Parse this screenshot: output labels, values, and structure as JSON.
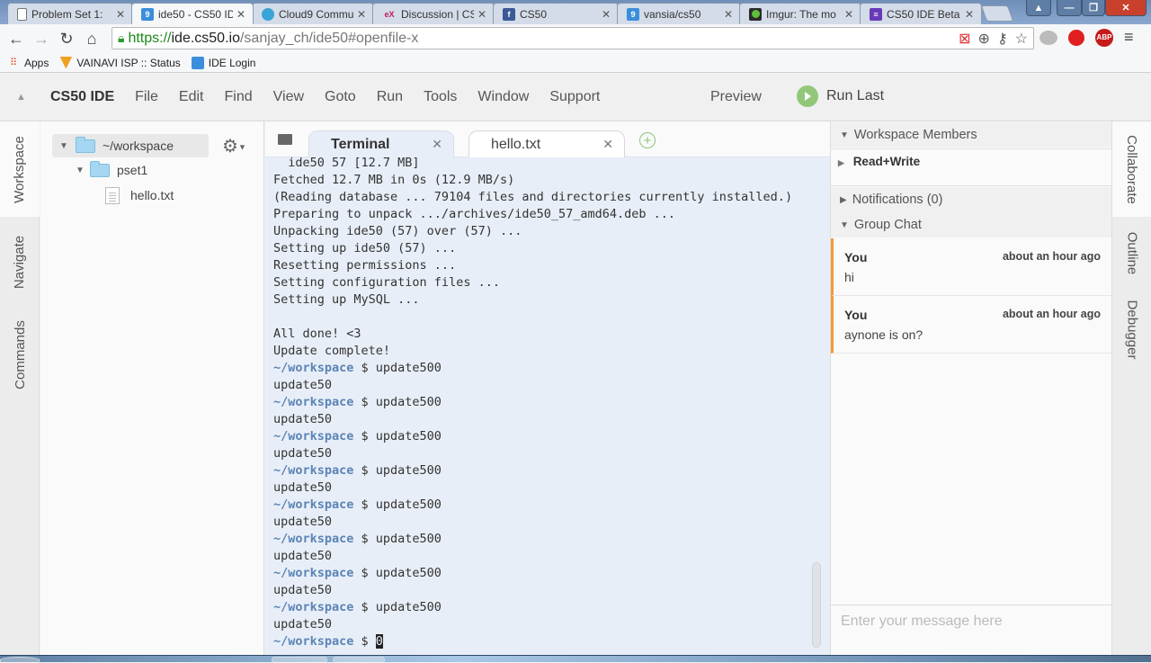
{
  "browser": {
    "tabs": [
      {
        "title": "Problem Set 1:",
        "favicon": "document-icon",
        "active": false
      },
      {
        "title": "ide50 - CS50 ID",
        "favicon": "cloud9-icon",
        "active": true
      },
      {
        "title": "Cloud9 Commu",
        "favicon": "cloud9-community-icon",
        "active": false
      },
      {
        "title": "Discussion | CS",
        "favicon": "edx-icon",
        "active": false
      },
      {
        "title": "CS50",
        "favicon": "facebook-icon",
        "active": false
      },
      {
        "title": "vansia/cs50",
        "favicon": "cloud9-icon",
        "active": false
      },
      {
        "title": "Imgur: The mo",
        "favicon": "imgur-icon",
        "active": false
      },
      {
        "title": "CS50 IDE Beta",
        "favicon": "form-icon",
        "active": false
      }
    ],
    "url": {
      "scheme": "https://",
      "host": "ide.cs50.io",
      "path": "/sanjay_ch/ide50#openfile-x"
    },
    "bookmarks": [
      {
        "label": "Apps",
        "icon": "apps-grid-icon"
      },
      {
        "label": "VAINAVI ISP :: Status",
        "icon": "shield-icon"
      },
      {
        "label": "IDE Login",
        "icon": "cloud9-icon"
      }
    ],
    "extensions": [
      "chat-bubbles-icon",
      "adblock-hand-icon",
      "abp-icon"
    ],
    "abp_label": "ABP"
  },
  "ide": {
    "brand": "CS50 IDE",
    "menu": [
      "File",
      "Edit",
      "Find",
      "View",
      "Goto",
      "Run",
      "Tools",
      "Window",
      "Support"
    ],
    "preview_label": "Preview",
    "run_last_label": "Run Last",
    "left_tabs": [
      "Workspace",
      "Navigate",
      "Commands"
    ],
    "right_tabs": [
      "Collaborate",
      "Outline",
      "Debugger"
    ],
    "tree": {
      "root": "~/workspace",
      "folder": "pset1",
      "file": "hello.txt"
    },
    "editor_tabs": [
      {
        "label": "Terminal",
        "active": true
      },
      {
        "label": "hello.txt",
        "active": false
      }
    ],
    "terminal": {
      "lines": [
        {
          "type": "out",
          "text": "  ide50 57 [12.7 MB]"
        },
        {
          "type": "out",
          "text": "Fetched 12.7 MB in 0s (12.9 MB/s)"
        },
        {
          "type": "out",
          "text": "(Reading database ... 79104 files and directories currently installed.)"
        },
        {
          "type": "out",
          "text": "Preparing to unpack .../archives/ide50_57_amd64.deb ..."
        },
        {
          "type": "out",
          "text": "Unpacking ide50 (57) over (57) ..."
        },
        {
          "type": "out",
          "text": "Setting up ide50 (57) ..."
        },
        {
          "type": "out",
          "text": "Resetting permissions ..."
        },
        {
          "type": "out",
          "text": "Setting configuration files ..."
        },
        {
          "type": "out",
          "text": "Setting up MySQL ..."
        },
        {
          "type": "out",
          "text": ""
        },
        {
          "type": "out",
          "text": "All done! <3"
        },
        {
          "type": "out",
          "text": "Update complete!"
        },
        {
          "type": "cmd",
          "prompt": "~/workspace",
          "text": " $ update500"
        },
        {
          "type": "out",
          "text": "update50"
        },
        {
          "type": "cmd",
          "prompt": "~/workspace",
          "text": " $ update500"
        },
        {
          "type": "out",
          "text": "update50"
        },
        {
          "type": "cmd",
          "prompt": "~/workspace",
          "text": " $ update500"
        },
        {
          "type": "out",
          "text": "update50"
        },
        {
          "type": "cmd",
          "prompt": "~/workspace",
          "text": " $ update500"
        },
        {
          "type": "out",
          "text": "update50"
        },
        {
          "type": "cmd",
          "prompt": "~/workspace",
          "text": " $ update500"
        },
        {
          "type": "out",
          "text": "update50"
        },
        {
          "type": "cmd",
          "prompt": "~/workspace",
          "text": " $ update500"
        },
        {
          "type": "out",
          "text": "update50"
        },
        {
          "type": "cmd",
          "prompt": "~/workspace",
          "text": " $ update500"
        },
        {
          "type": "out",
          "text": "update50"
        },
        {
          "type": "cmd",
          "prompt": "~/workspace",
          "text": " $ update500"
        },
        {
          "type": "out",
          "text": "update50"
        },
        {
          "type": "cur",
          "prompt": "~/workspace",
          "text": " $ ",
          "cursor": "0"
        }
      ]
    },
    "collab": {
      "members_title": "Workspace Members",
      "members_group": "Read+Write",
      "notifications": "Notifications (0)",
      "group_chat": "Group Chat",
      "messages": [
        {
          "author": "You",
          "time": "about an hour ago",
          "text": "hi"
        },
        {
          "author": "You",
          "time": "about an hour ago",
          "text": "aynone is on?"
        }
      ],
      "input_placeholder": "Enter your message here"
    }
  },
  "colors": {
    "accent_orange": "#f29a3a",
    "prompt_blue": "#5a84b6",
    "run_green": "#92c77a",
    "terminal_bg": "#e8eef7"
  }
}
